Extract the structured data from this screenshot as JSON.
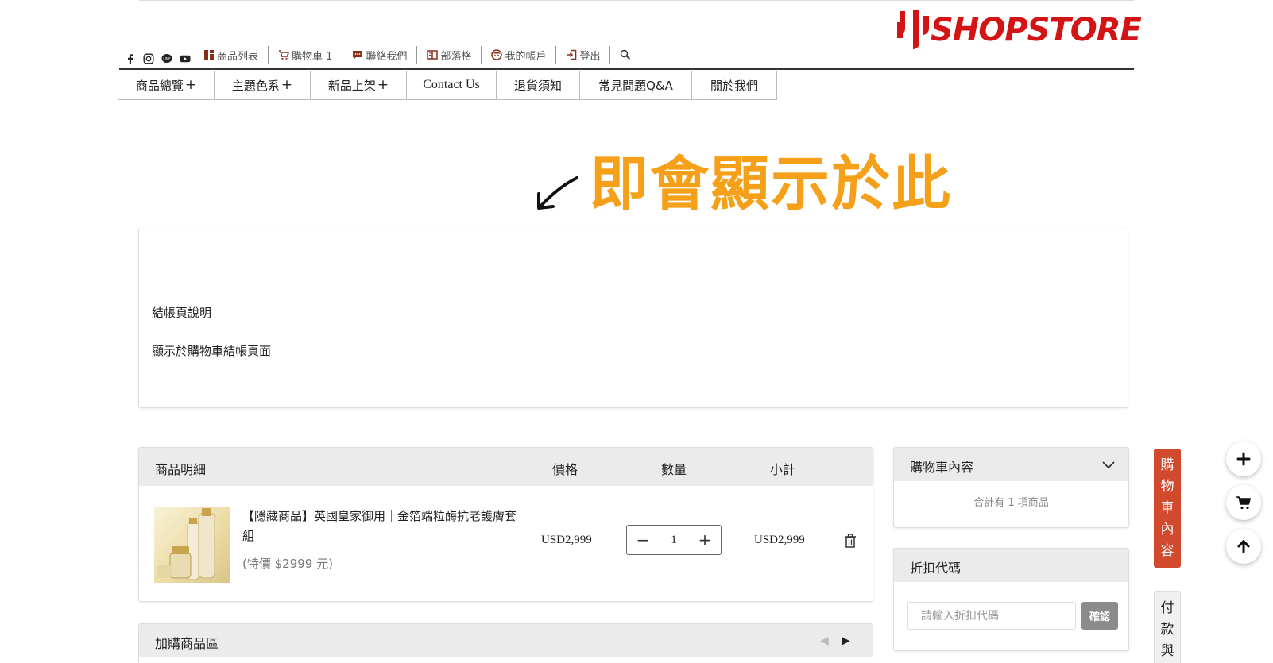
{
  "brand": {
    "logo_text": "SHOPSTORE",
    "color": "#d41414"
  },
  "social_icons": [
    "facebook-icon",
    "instagram-icon",
    "line-icon",
    "youtube-icon"
  ],
  "topnav": {
    "products": "商品列表",
    "cart": "購物車 1",
    "contact": "聯絡我們",
    "blog": "部落格",
    "account": "我的帳戶",
    "logout": "登出"
  },
  "mainnav": {
    "items": [
      {
        "label": "商品總覽",
        "plus": "+"
      },
      {
        "label": "主題色系",
        "plus": "+"
      },
      {
        "label": "新品上架",
        "plus": "+"
      },
      {
        "label": "Contact Us"
      },
      {
        "label": "退貨須知"
      },
      {
        "label": "常見問題Q&A"
      },
      {
        "label": "關於我們"
      }
    ]
  },
  "annotation": {
    "text": "即會顯示於此",
    "color": "#f5a018"
  },
  "description": {
    "line1": "結帳頁說明",
    "line2": "顯示於購物車結帳頁面"
  },
  "cart": {
    "headers": {
      "detail": "商品明細",
      "price": "價格",
      "qty": "數量",
      "subtotal": "小計"
    },
    "item": {
      "name": "【隱藏商品】英國皇家御用｜金箔端粒酶抗老護膚套組",
      "sub": "(特價 $2999 元)",
      "price": "USD2,999",
      "qty": "1",
      "subtotal": "USD2,999",
      "minus": "−",
      "plus": "+"
    }
  },
  "addon": {
    "title": "加購商品區",
    "prev": "◀",
    "next": "▶"
  },
  "summary": {
    "title": "購物車內容",
    "count": "合計有 1 項商品"
  },
  "coupon": {
    "title": "折扣代碼",
    "placeholder": "請輸入折扣代碼",
    "button": "確認"
  },
  "sidetabs": {
    "cart_content": [
      "購",
      "物",
      "車",
      "內",
      "容"
    ],
    "payment": [
      "付",
      "款",
      "與"
    ]
  },
  "colors": {
    "accent_red": "#d14a2e",
    "header_bg": "#ebebeb"
  }
}
